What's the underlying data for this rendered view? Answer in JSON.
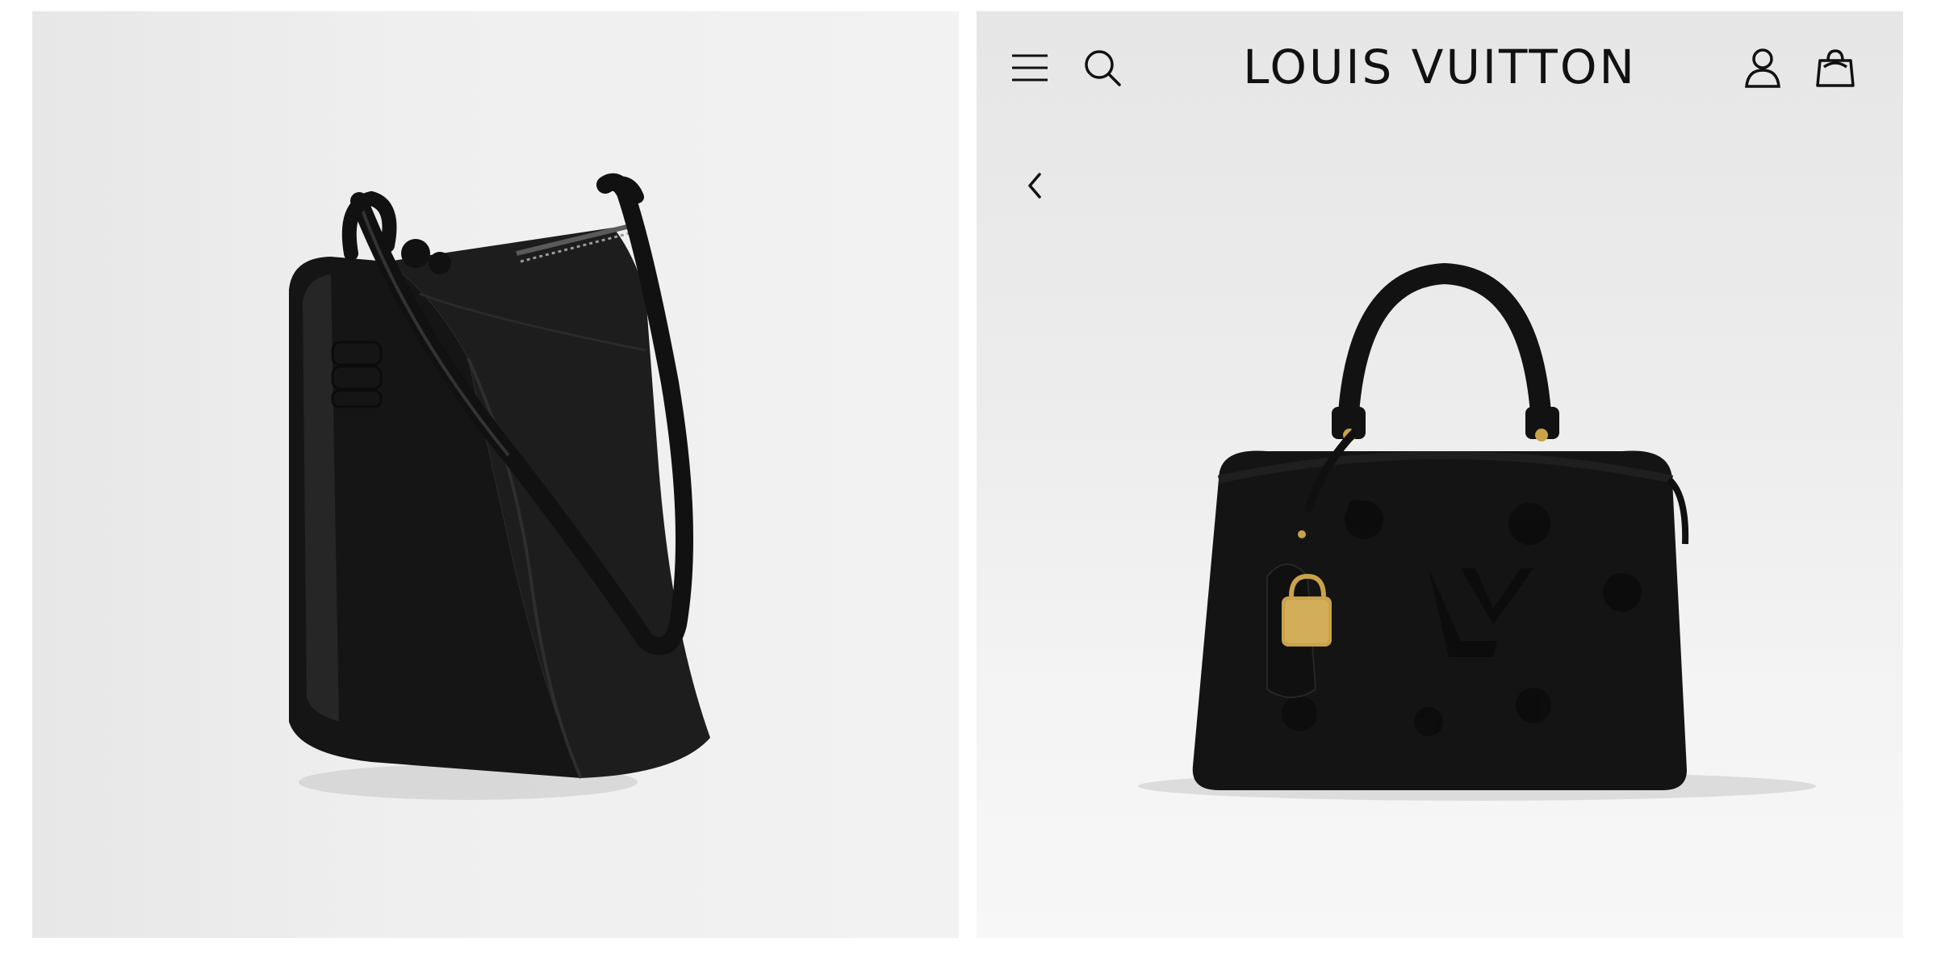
{
  "brand": {
    "logo_text": "LOUIS VUITTON"
  },
  "header": {
    "icons": [
      "menu-icon",
      "search-icon",
      "account-icon",
      "shopping-bag-icon"
    ]
  },
  "navigation": {
    "back_icon": "chevron-left-icon"
  },
  "colors": {
    "bag_black": "#141414",
    "hardware_gold": "#c9a24a",
    "page_background": "#ffffff"
  }
}
